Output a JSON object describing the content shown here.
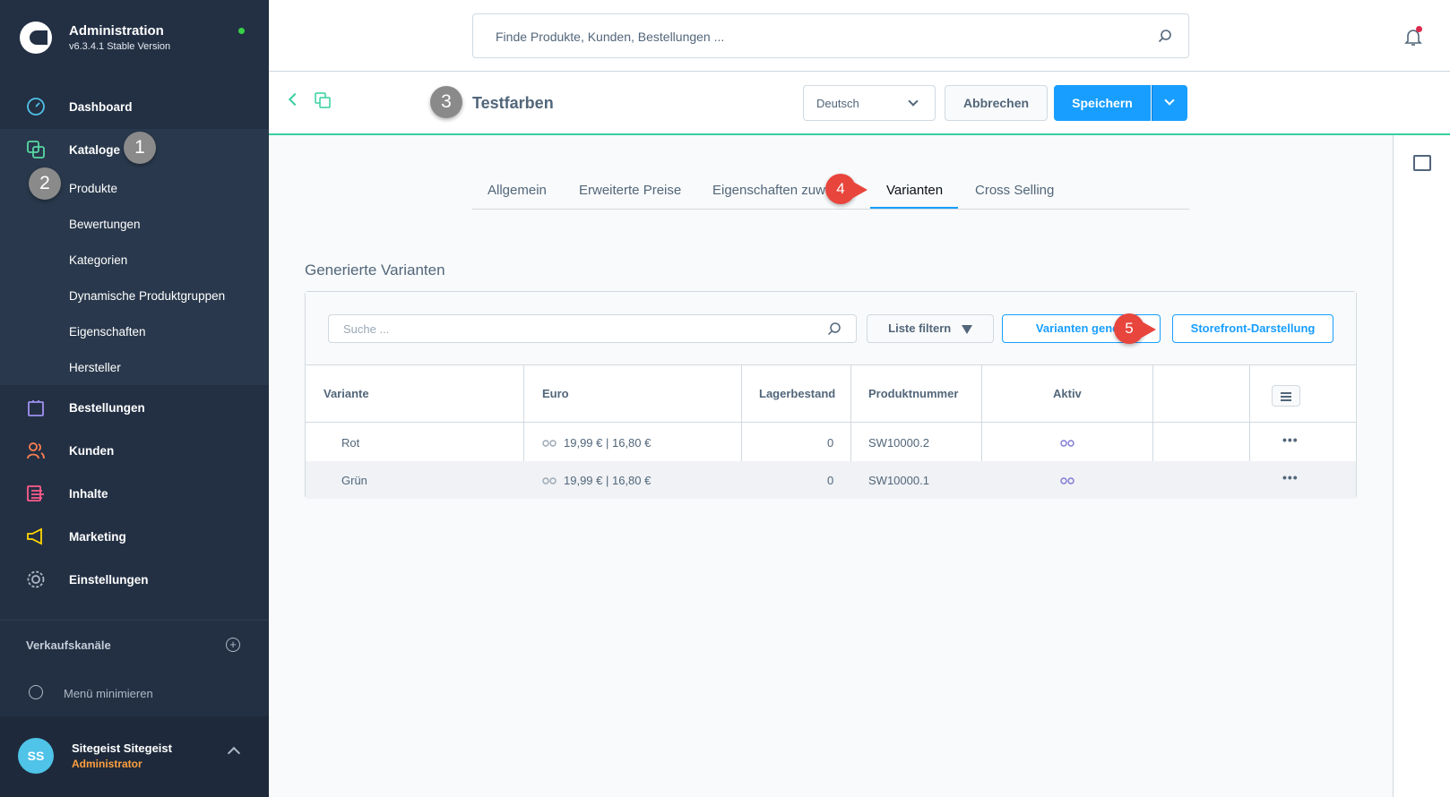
{
  "app": {
    "title": "Administration",
    "version": "v6.3.4.1 Stable Version"
  },
  "sidebar": {
    "items": [
      {
        "label": "Dashboard",
        "icon": "dashboard-icon"
      },
      {
        "label": "Kataloge",
        "icon": "catalog-icon"
      },
      {
        "label": "Bestellungen",
        "icon": "bag-icon"
      },
      {
        "label": "Kunden",
        "icon": "users-icon"
      },
      {
        "label": "Inhalte",
        "icon": "content-icon"
      },
      {
        "label": "Marketing",
        "icon": "megaphone-icon"
      },
      {
        "label": "Einstellungen",
        "icon": "gear-icon"
      }
    ],
    "sub_items": [
      "Produkte",
      "Bewertungen",
      "Kategorien",
      "Dynamische Produktgruppen",
      "Eigenschaften",
      "Hersteller"
    ],
    "sales_channels": "Verkaufskanäle",
    "minimize": "Menü minimieren",
    "user": {
      "initials": "SS",
      "name": "Sitegeist Sitegeist",
      "role": "Administrator"
    }
  },
  "search": {
    "placeholder": "Finde Produkte, Kunden, Bestellungen ..."
  },
  "smartbar": {
    "title": "Testfarben",
    "language": "Deutsch",
    "cancel": "Abbrechen",
    "save": "Speichern"
  },
  "tabs": [
    "Allgemein",
    "Erweiterte Preise",
    "Eigenschaften zuw",
    "Varianten",
    "Cross Selling"
  ],
  "section": {
    "title": "Generierte Varianten"
  },
  "table": {
    "search_placeholder": "Suche ...",
    "filter_label": "Liste filtern",
    "generate_label": "Varianten generi",
    "storefront_label": "Storefront-Darstellung",
    "columns": [
      "Variante",
      "Euro",
      "Lagerbestand",
      "Produktnummer",
      "Aktiv"
    ],
    "rows": [
      {
        "variant": "Rot",
        "price": "19,99 € | 16,80 €",
        "stock": "0",
        "number": "SW10000.2"
      },
      {
        "variant": "Grün",
        "price": "19,99 € | 16,80 €",
        "stock": "0",
        "number": "SW10000.1"
      }
    ]
  },
  "badges": [
    "1",
    "2",
    "3",
    "4",
    "5"
  ],
  "colors": {
    "sidebar": "#233044",
    "accent": "#189eff",
    "success": "#37d0a0",
    "annotation": "#e8453c"
  }
}
